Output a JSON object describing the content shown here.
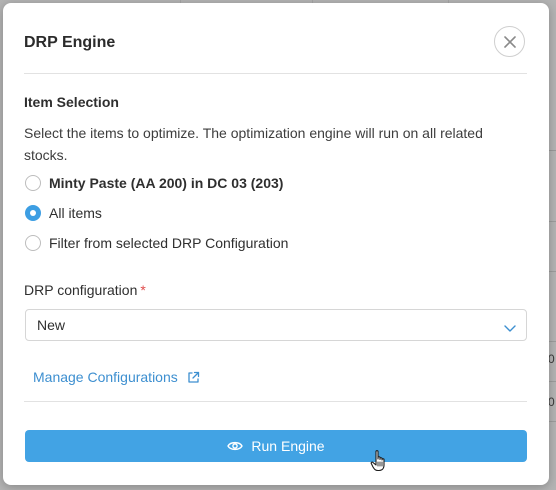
{
  "background": {
    "fragments": [
      "0",
      "0"
    ]
  },
  "dialog": {
    "title": "DRP Engine",
    "close_icon": "close-icon",
    "item_selection": {
      "heading": "Item Selection",
      "description": "Select the items to optimize. The optimization engine will run on all related stocks.",
      "options": [
        {
          "label": "Minty Paste (AA 200) in DC 03 (203)",
          "selected": false,
          "bold": true
        },
        {
          "label": "All items",
          "selected": true,
          "bold": false
        },
        {
          "label": "Filter from selected DRP Configuration",
          "selected": false,
          "bold": false
        }
      ]
    },
    "drp_configuration": {
      "label": "DRP configuration",
      "required_marker": "*",
      "value": "New",
      "chevron_icon": "chevron-down-icon"
    },
    "manage_link": {
      "label": "Manage Configurations",
      "icon": "external-link-icon"
    },
    "run_button": {
      "label": "Run Engine",
      "icon": "eye-icon"
    }
  },
  "colors": {
    "accent": "#42a3e4",
    "link": "#3d8fd0",
    "required": "#e04b4b",
    "backdrop": "#b4b4b4"
  }
}
